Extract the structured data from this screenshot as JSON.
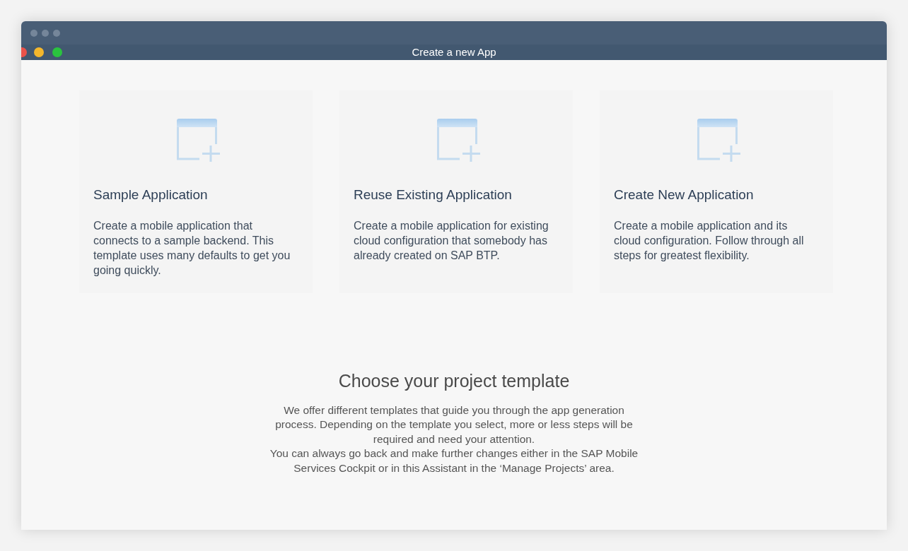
{
  "window": {
    "title": "Create a new App"
  },
  "templates": [
    {
      "title": "Sample Application",
      "description": "Create a mobile application that connects to a sample backend. This template uses many defaults to get you going quickly."
    },
    {
      "title": "Reuse Existing Application",
      "description": "Create a mobile application for existing cloud configuration that somebody has already created on SAP BTP."
    },
    {
      "title": "Create New Application",
      "description": "Create a mobile application and its cloud configuration. Follow through all steps for greatest flexibility."
    }
  ],
  "intro": {
    "heading": "Choose your project template",
    "paragraphs": [
      "We offer different templates that guide you through the app generation process. Depending on the template you select, more or less steps will be required and need your attention.",
      "You can always go back and make further changes either in the SAP Mobile Services Cockpit or in this Assistant in the ‘Manage Projects’ area."
    ]
  }
}
